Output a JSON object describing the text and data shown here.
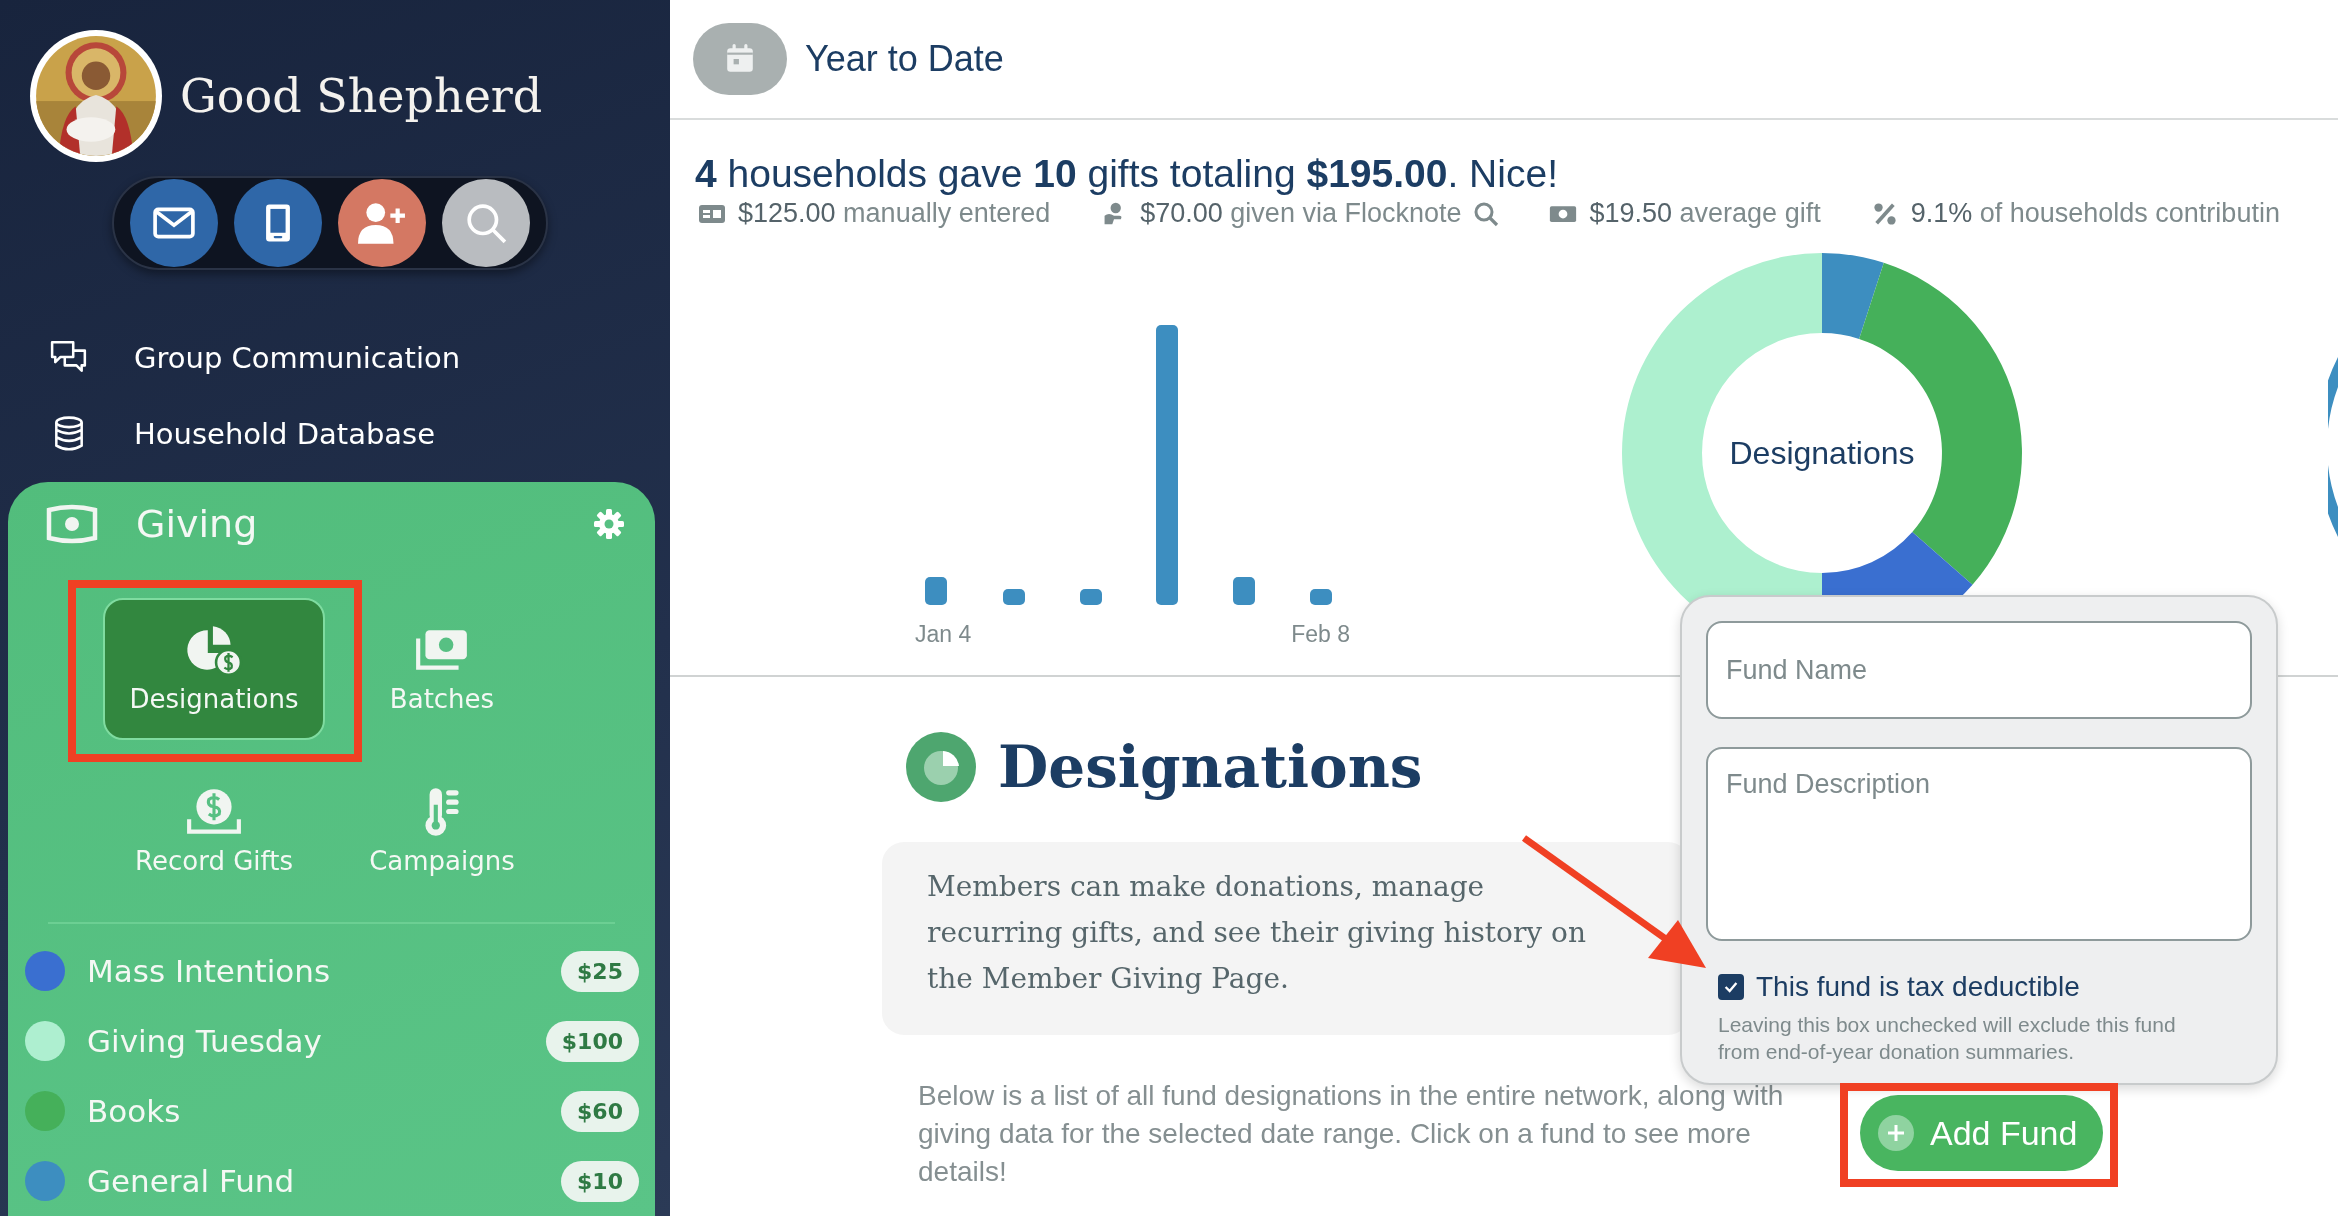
{
  "sidebar": {
    "org_name": "Good Shepherd",
    "nav": [
      {
        "label": "Group Communication",
        "kind": "chat"
      },
      {
        "label": "Household Database",
        "kind": "database"
      }
    ],
    "giving": {
      "title": "Giving",
      "tiles": [
        {
          "label": "Designations",
          "kind": "designations",
          "selected": true
        },
        {
          "label": "Batches",
          "kind": "batches",
          "selected": false
        },
        {
          "label": "Record Gifts",
          "kind": "record",
          "selected": false
        },
        {
          "label": "Campaigns",
          "kind": "campaigns",
          "selected": false
        }
      ],
      "funds": [
        {
          "name": "Mass Intentions",
          "color": "#3a6fd0",
          "amount": "$25"
        },
        {
          "name": "Giving Tuesday",
          "color": "#aeefd0",
          "amount": "$100"
        },
        {
          "name": "Books",
          "color": "#45b05a",
          "amount": "$60"
        },
        {
          "name": "General Fund",
          "color": "#3d8ec0",
          "amount": "$10"
        }
      ]
    }
  },
  "main": {
    "period": "Year to Date",
    "summary": "**4** households gave **10** gifts totaling **$195.00**. Nice!",
    "stats": [
      {
        "kind": "manual",
        "text": "**$125.00** manually entered"
      },
      {
        "kind": "online",
        "text": "**$70.00** given via Flocknote"
      },
      {
        "kind": "average",
        "text": "**$19.50** average gift"
      },
      {
        "kind": "percent",
        "text": "**9.1%** of households contributin"
      }
    ],
    "bar_labels": [
      "Jan 4",
      "Feb 8"
    ],
    "donut_label": "Designations",
    "section": {
      "title": "Designations",
      "note": "Members can make donations, manage recurring gifts, and see their giving history on the Member Giving Page.",
      "description": "Below is a list of all fund designations in the entire network, along with giving data for the selected date range. Click on a fund to see more details!",
      "add_button": "Add Fund"
    },
    "popover": {
      "name_placeholder": "Fund Name",
      "description_placeholder": "Fund Description",
      "tax": {
        "label": "This fund is tax deductible",
        "checked": true
      },
      "help": "Leaving this box unchecked will exclude this fund from end-of-year donation summaries."
    }
  }
}
